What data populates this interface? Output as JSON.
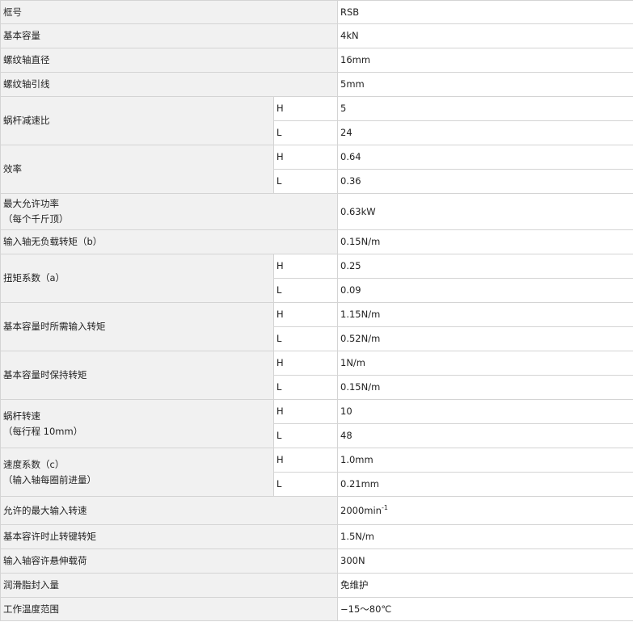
{
  "header": {
    "label": "框号",
    "value": "RSB"
  },
  "rows": {
    "basic_capacity": {
      "label": "基本容量",
      "value": "4kN"
    },
    "screw_diameter": {
      "label": "螺纹轴直径",
      "value": "16mm"
    },
    "screw_lead": {
      "label": "螺纹轴引线",
      "value": "5mm"
    },
    "worm_ratio": {
      "label": "蜗杆减速比",
      "h_label": "H",
      "h_value": "5",
      "l_label": "L",
      "l_value": "24"
    },
    "efficiency": {
      "label": "效率",
      "h_label": "H",
      "h_value": "0.64",
      "l_label": "L",
      "l_value": "0.36"
    },
    "max_power": {
      "label": "最大允许功率",
      "label_sub": "（每个千斤顶）",
      "value": "0.63kW"
    },
    "no_load_torque": {
      "label": "输入轴无负载转矩（b）",
      "value": "0.15N/m"
    },
    "torque_coefficient": {
      "label": "扭矩系数（a）",
      "h_label": "H",
      "h_value": "0.25",
      "l_label": "L",
      "l_value": "0.09"
    },
    "required_input_torque": {
      "label": "基本容量时所需输入转矩",
      "h_label": "H",
      "h_value": "1.15N/m",
      "l_label": "L",
      "l_value": "0.52N/m"
    },
    "holding_torque": {
      "label": "基本容量时保持转矩",
      "h_label": "H",
      "h_value": "1N/m",
      "l_label": "L",
      "l_value": "0.15N/m"
    },
    "worm_speed": {
      "label": "蜗杆转速",
      "label_sub": "（每行程 10mm）",
      "h_label": "H",
      "h_value": "10",
      "l_label": "L",
      "l_value": "48"
    },
    "speed_coefficient": {
      "label": "速度系数（c）",
      "label_sub": "（输入轴每圈前进量）",
      "h_label": "H",
      "h_value": "1.0mm",
      "l_label": "L",
      "l_value": "0.21mm"
    },
    "max_input_speed": {
      "label": "允许的最大输入转速",
      "value": "2000min",
      "value_sup": "-1"
    },
    "anti_rotation_torque": {
      "label": "基本容许时止转键转矩",
      "value": "1.5N/m"
    },
    "overhung_load": {
      "label": "输入轴容许悬伸载荷",
      "value": "300N"
    },
    "lubricant": {
      "label": "润滑脂封入量",
      "value": "免维护"
    },
    "operating_temp": {
      "label": "工作温度范围",
      "value": "−15～80℃"
    }
  }
}
